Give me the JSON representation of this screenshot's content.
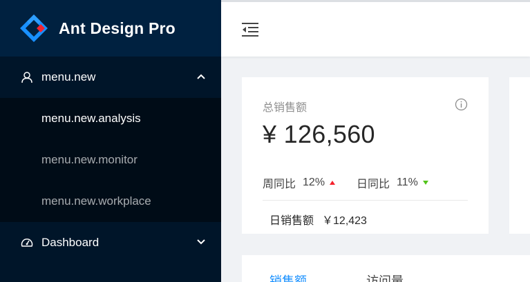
{
  "app": {
    "title": "Ant Design Pro"
  },
  "sidebar": {
    "groups": [
      {
        "label": "menu.new",
        "icon": "user-icon",
        "expanded": true,
        "items": [
          {
            "label": "menu.new.analysis",
            "selected": true
          },
          {
            "label": "menu.new.monitor",
            "selected": false
          },
          {
            "label": "menu.new.workplace",
            "selected": false
          }
        ]
      },
      {
        "label": "Dashboard",
        "icon": "dashboard-icon",
        "expanded": false
      }
    ]
  },
  "header": {
    "trigger_icon": "menu-fold-icon"
  },
  "sales_card": {
    "label": "总销售额",
    "total": "¥ 126,560",
    "weekly_label": "周同比",
    "weekly_value": "12%",
    "daily_label": "日同比",
    "daily_value": "11%",
    "daily_sales_label": "日销售额",
    "daily_sales_value": "￥12,423"
  },
  "tabs": [
    {
      "label": "销售额",
      "active": true
    },
    {
      "label": "访问量",
      "active": false
    }
  ],
  "colors": {
    "sidebar": "#001529",
    "logo_bg": "#002140",
    "submenu_bg": "#000c17",
    "primary": "#1890ff",
    "up": "#f5222d",
    "down": "#52c41a"
  }
}
